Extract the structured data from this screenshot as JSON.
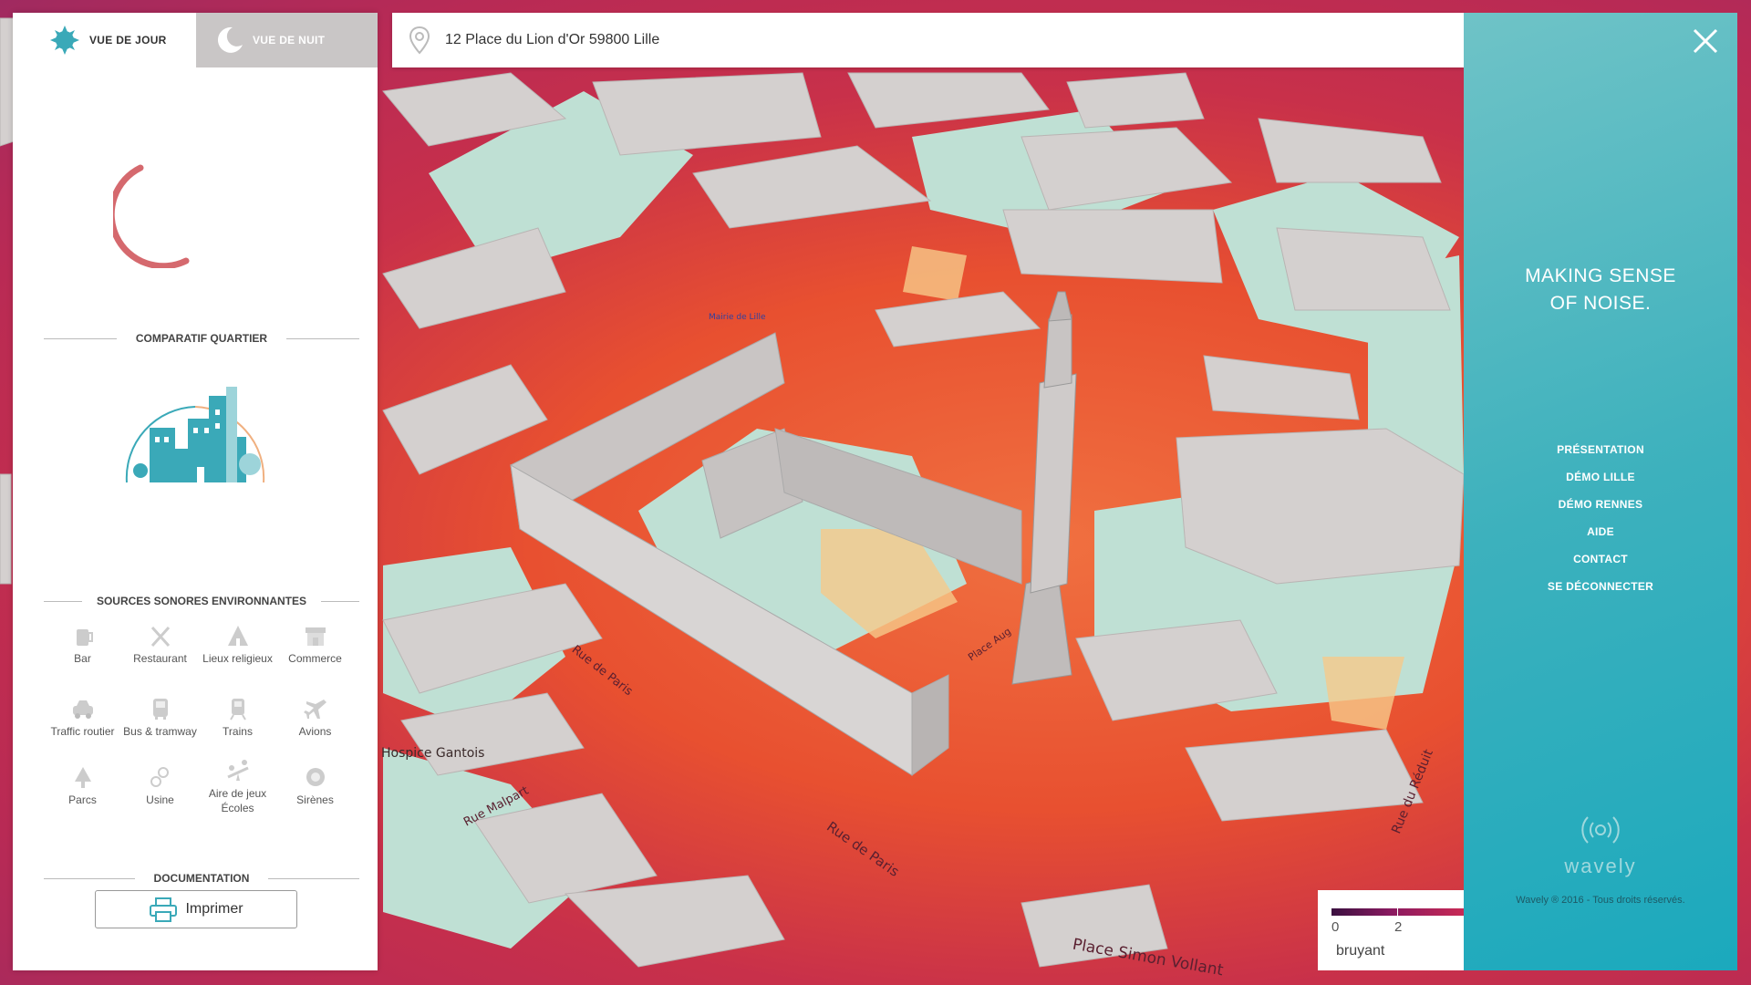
{
  "tabs": {
    "day": "VUE DE JOUR",
    "night": "VUE DE NUIT"
  },
  "search": {
    "value": "12 Place du Lion d'Or 59800 Lille",
    "placeholder": ""
  },
  "comparatif": {
    "title": "COMPARATIF QUARTIER"
  },
  "sources": {
    "title": "SOURCES SONORES ENVIRONNANTES",
    "items": [
      {
        "label": "Bar",
        "icon": "beer-icon"
      },
      {
        "label": "Restaurant",
        "icon": "utensils-icon"
      },
      {
        "label": "Lieux religieux",
        "icon": "religious-icon"
      },
      {
        "label": "Commerce",
        "icon": "shop-icon"
      },
      {
        "label": "Traffic routier",
        "icon": "car-icon"
      },
      {
        "label": "Bus & tramway",
        "icon": "bus-icon"
      },
      {
        "label": "Trains",
        "icon": "train-icon"
      },
      {
        "label": "Avions",
        "icon": "plane-icon"
      },
      {
        "label": "Parcs",
        "icon": "tree-icon"
      },
      {
        "label": "Usine",
        "icon": "factory-icon"
      },
      {
        "label": "Aire de jeux",
        "label2": "Écoles",
        "icon": "playground-icon"
      },
      {
        "label": "Sirènes",
        "icon": "siren-icon"
      }
    ]
  },
  "documentation": {
    "title": "DOCUMENTATION",
    "print_label": "Imprimer"
  },
  "right_panel": {
    "tagline_1": "MAKING SENSE",
    "tagline_2": "OF NOISE.",
    "menu": [
      "PRÉSENTATION",
      "DÉMO LILLE",
      "DÉMO RENNES",
      "AIDE",
      "CONTACT",
      "SE DÉCONNECTER"
    ],
    "brand": "wavely",
    "copyright": "Wavely ® 2016 - Tous droits réservés."
  },
  "map": {
    "labels": {
      "mairie": "Mairie de Lille",
      "gantois": "Hospice Gantois",
      "rue_de_paris_1": "Rue de Paris",
      "rue_de_paris_2": "Rue de Paris",
      "rue_malpart": "Rue Malpart",
      "rue_du_reduit": "Rue du Réduit",
      "place_simon": "Place Simon Vollant",
      "place_aug": "Place Aug"
    }
  },
  "legend": {
    "tick_0": "0",
    "tick_2": "2",
    "label": "bruyant"
  },
  "colors": {
    "accent": "#3db1bd",
    "noise_high": "#b82a55",
    "noise_mid": "#f07040",
    "noise_low": "#f6c98a",
    "quiet": "#bde0d2",
    "building": "#d4d0cf"
  }
}
